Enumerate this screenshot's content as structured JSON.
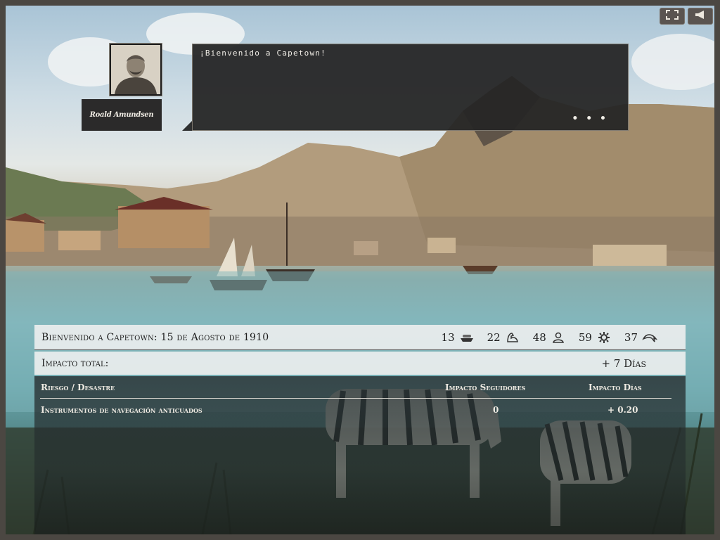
{
  "controls": {
    "fullscreen_icon": "fullscreen-icon",
    "sound_icon": "speaker-icon"
  },
  "character": {
    "name": "Roald Amundsen"
  },
  "dialog": {
    "text": "¡Bienvenido a Capetown!",
    "more": "• • •"
  },
  "header": {
    "title": "Bienvenido a Capetown: 15 de Agosto de 1910",
    "stats": [
      {
        "value": "13",
        "icon": "ship-icon"
      },
      {
        "value": "22",
        "icon": "strength-icon"
      },
      {
        "value": "48",
        "icon": "followers-icon"
      },
      {
        "value": "59",
        "icon": "gear-icon"
      },
      {
        "value": "37",
        "icon": "dolphin-icon"
      }
    ]
  },
  "impact": {
    "label": "Impacto total:",
    "value": "+ 7  Días"
  },
  "risk_table": {
    "headers": [
      "Riesgo / Desastre",
      "Impacto Seguidores",
      "Impacto Días"
    ],
    "rows": [
      {
        "risk": "Instrumentos de navegación anticuados",
        "followers": "0",
        "days": "+ 0.20"
      }
    ]
  }
}
